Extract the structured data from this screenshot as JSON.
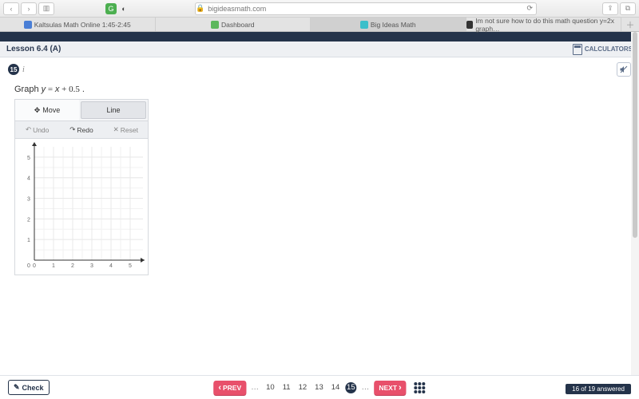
{
  "browser": {
    "url_host": "bigideasmath.com",
    "lock": true,
    "tabs": [
      {
        "label": "Kaltsulas Math Online 1:45-2:45",
        "fav": "fav-blue"
      },
      {
        "label": "Dashboard",
        "fav": "fav-green"
      },
      {
        "label": "Big Ideas Math",
        "fav": "fav-teal",
        "active": true
      },
      {
        "label": "Im not sure how to do this math question y=2x graph…",
        "fav": "fav-dark"
      }
    ]
  },
  "app": {
    "center_name": "",
    "lesson_title": "Lesson 6.4 (A)",
    "calculators_label": "CALCULATORS"
  },
  "question": {
    "number": "15",
    "prompt_prefix": "Graph ",
    "equation": "y = x + 0.5",
    "prompt_suffix": " ."
  },
  "graph_widget": {
    "tools": {
      "move": "Move",
      "line": "Line",
      "selected": "line"
    },
    "actions": {
      "undo": "Undo",
      "redo": "Redo",
      "reset": "Reset",
      "undo_enabled": false,
      "redo_enabled": true,
      "reset_enabled": false
    }
  },
  "chart_data": {
    "type": "scatter",
    "series": [],
    "x_ticks": [
      0,
      1,
      2,
      3,
      4,
      5
    ],
    "y_ticks": [
      1,
      2,
      3,
      4,
      5
    ],
    "xlim": [
      0,
      5.5
    ],
    "ylim": [
      0,
      5.5
    ],
    "xlabel": "",
    "ylabel": "",
    "title": "",
    "grid": true
  },
  "footer": {
    "check_label": "Check",
    "prev_label": "PREV",
    "next_label": "NEXT",
    "pages_visible": [
      "10",
      "11",
      "12",
      "13",
      "14",
      "15"
    ],
    "current_page": "15",
    "answered_text": "16 of 19 answered"
  }
}
